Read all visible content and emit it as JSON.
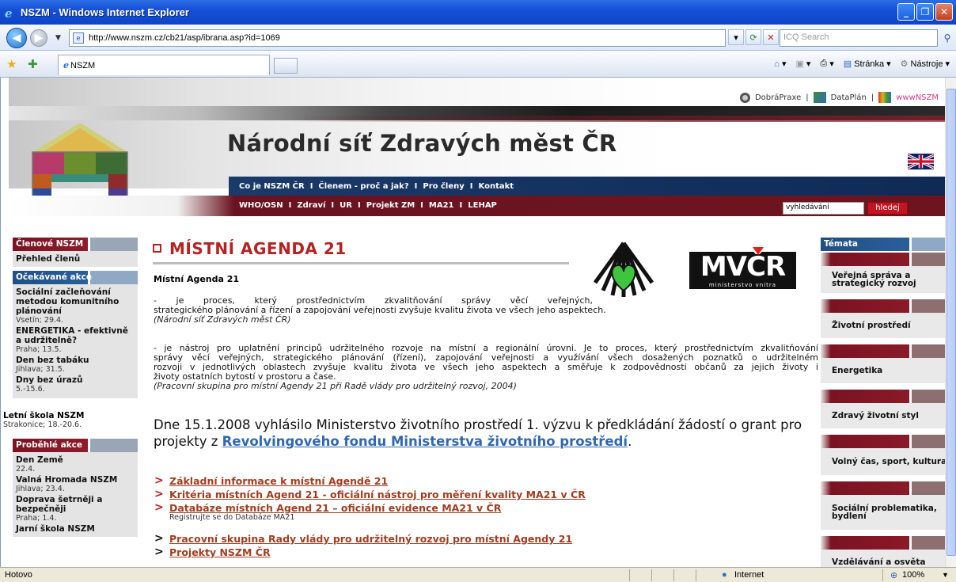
{
  "window": {
    "title": "NSZM - Windows Internet Explorer"
  },
  "navbar": {
    "url": "http://www.nszm.cz/cb21/asp/ibrana.asp?id=1069",
    "search_placeholder": "ICQ Search"
  },
  "tabs": [
    {
      "label": "NSZM"
    }
  ],
  "toolbar": {
    "page_label": "Stránka",
    "tools_label": "Nástroje"
  },
  "header": {
    "ext_links": [
      "DobráPraxe",
      "DataPlán",
      "wwwNSZM"
    ],
    "site_title": "Národní síť Zdravých měst ČR",
    "menu1": [
      "Co je NSZM ČR",
      "Členem - proč a jak?",
      "Pro členy",
      "Kontakt"
    ],
    "menu2": [
      "WHO/OSN",
      "Zdraví",
      "UR",
      "Projekt ZM",
      "MA21",
      "LEHAP"
    ],
    "search_value": "vyhledávání",
    "search_button": "hledej"
  },
  "left": {
    "members_head": "Členové NSZM",
    "members_link": "Přehled členů",
    "upcoming_head": "Očekávané akce",
    "upcoming": [
      {
        "title": "Sociální začleňování metodou komunitního plánování",
        "sub": "Vsetín; 29.4."
      },
      {
        "title": "ENERGETIKA - efektivně a udržitelně?",
        "sub": "Praha; 13.5."
      },
      {
        "title": "Den bez tabáku",
        "sub": "Jihlava; 31.5."
      },
      {
        "title": "Dny bez úrazů",
        "sub": "5.-15.6."
      }
    ],
    "school": {
      "title": "Letní škola NSZM",
      "sub": "Strakonice; 18.-20.6."
    },
    "past_head": "Proběhlé akce",
    "past": [
      {
        "title": "Den Země",
        "sub": "22.4."
      },
      {
        "title": "Valná Hromada NSZM",
        "sub": "Jihlava; 23.4."
      },
      {
        "title": "Doprava šetrněji a bezpečněji",
        "sub": "Praha; 1.4."
      },
      {
        "title": "Jarní škola NSZM",
        "sub": ""
      }
    ]
  },
  "main": {
    "title": "MÍSTNÍ AGENDA 21",
    "subtitle": "Místní Agenda 21",
    "p1_line1": "- je proces, který prostřednictvím zkvalitňování správy věcí veřejných,",
    "p1_line2": "strategického plánování a řízení a zapojování veřejnosti zvyšuje kvalitu života ve všech jeho aspektech.",
    "p1_src": "(Národní síť Zdravých měst ČR)",
    "p2_line1": "- je nástroj pro uplatnění principů udržitelného rozvoje na místní a regionální úrovni. Je to proces, který prostřednictvím zkvalitňování",
    "p2_line2": "správy věcí veřejných, strategického plánování (řízení), zapojování veřejnosti a využívání všech dosažených poznatků o udržitelném",
    "p2_line3": "rozvoji v jednotlivých oblastech zvyšuje kvalitu života ve všech jeho aspektech a směřuje k zodpovědnosti občanů za jejich životy i",
    "p2_line4": "životy ostatních bytostí v prostoru a čase.",
    "p2_src": "(Pracovní skupina pro místní Agendy 21 při Radě vlády pro udržitelný rozvoj, 2004)",
    "big_text": "Dne 15.1.2008 vyhlásilo Ministerstvo životního prostředí 1. výzvu k předkládání žádostí o grant pro projekty z",
    "big_link": "Revolvingového fondu Ministerstva životního prostředí",
    "big_end": ".",
    "mvcr_text": "MVČR",
    "mvcr_sub": "ministerstvo vnitra",
    "links": [
      "Základní informace k místní Agendě 21",
      "Kritéria místních Agend 21 - oficiální nástroj pro měření kvality MA21 v ČR",
      "Databáze místních Agend 21 – oficiální evidence MA21 v ČR"
    ],
    "register_note": "Registrujte se do Databáze MA21",
    "link4": "Pracovní skupina Rady vlády pro udržitelný rozvoj pro místní Agendy 21",
    "link5": "Projekty NSZM ČR"
  },
  "right": {
    "head": "Témata",
    "items": [
      "Veřejná správa a strategický rozvoj",
      "Životní prostředí",
      "Energetika",
      "Zdravý životní styl",
      "Volný čas, sport, kultura",
      "Sociální problematika, bydlení",
      "Vzdělávání a osvěta"
    ]
  },
  "status": {
    "left": "Hotovo",
    "zone": "Internet",
    "zoom": "100%"
  }
}
